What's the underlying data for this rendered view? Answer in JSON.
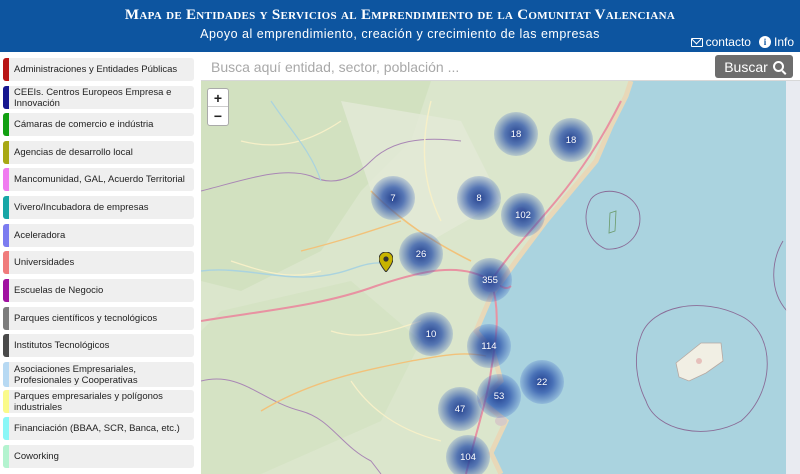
{
  "header": {
    "title": "Mapa de Entidades y Servicios al Emprendimiento de la Comunitat Valenciana",
    "subtitle": "Apoyo al emprendimiento, creación y crecimiento de las empresas",
    "contact_label": "contacto",
    "info_label": "Info",
    "background": "#0d55a0"
  },
  "sidebar": {
    "items": [
      {
        "label": "Administraciones y Entidades Públicas",
        "color": "#b81414"
      },
      {
        "label": "CEEIs. Centros Europeos Empresa e Innovación",
        "color": "#16168f"
      },
      {
        "label": "Cámaras de comercio e indústria",
        "color": "#12a012"
      },
      {
        "label": "Agencias de desarrollo local",
        "color": "#a8a814"
      },
      {
        "label": "Mancomunidad, GAL, Acuerdo Territorial",
        "color": "#f07bf0"
      },
      {
        "label": "Vivero/Incubadora de empresas",
        "color": "#17a6a6"
      },
      {
        "label": "Aceleradora",
        "color": "#7b7bf0"
      },
      {
        "label": "Universidades",
        "color": "#f07b7b"
      },
      {
        "label": "Escuelas de Negocio",
        "color": "#a011a0"
      },
      {
        "label": "Parques científicos y tecnológicos",
        "color": "#7c7c7c"
      },
      {
        "label": "Institutos Tecnológicos",
        "color": "#4a4a4a"
      },
      {
        "label": "Asociaciones Empresariales, Profesionales y Cooperativas",
        "color": "#b7d9f3"
      },
      {
        "label": "Parques empresariales y polígonos industriales",
        "color": "#fafa8a"
      },
      {
        "label": "Financiación (BBAA, SCR, Banca, etc.)",
        "color": "#8af7f7"
      },
      {
        "label": "Coworking",
        "color": "#b3f3cf"
      }
    ]
  },
  "search": {
    "placeholder": "Busca aquí entidad, sector, población ...",
    "button_label": "Buscar"
  },
  "map": {
    "zoom_in_label": "+",
    "zoom_out_label": "−",
    "clusters": [
      {
        "count": "18"
      },
      {
        "count": "18"
      },
      {
        "count": "7"
      },
      {
        "count": "8"
      },
      {
        "count": "102"
      },
      {
        "count": "26"
      },
      {
        "count": "355"
      },
      {
        "count": "10"
      },
      {
        "count": "114"
      },
      {
        "count": "22"
      },
      {
        "count": "53"
      },
      {
        "count": "47"
      },
      {
        "count": "104"
      }
    ],
    "marker_color": "#c8b400",
    "sea_color": "#a9cde0"
  }
}
